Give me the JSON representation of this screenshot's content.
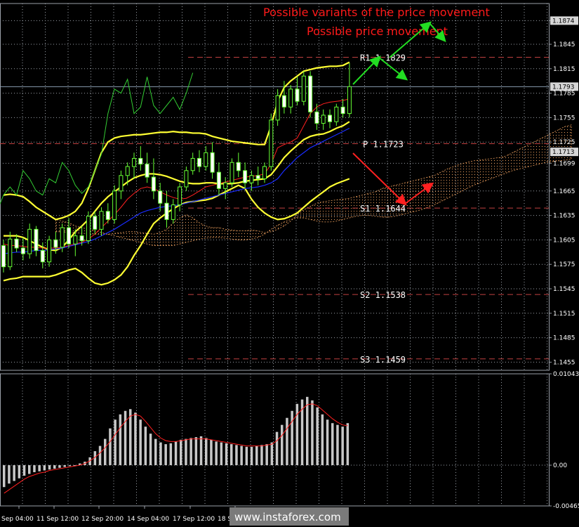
{
  "colors": {
    "background": "#000000",
    "grid": "#9aa0a8",
    "candle_up": "#66ff33",
    "candle_down": "#ffffff",
    "bollinger": "#ffff33",
    "kijun": "#ff2020",
    "tenkan": "#1a2cff",
    "chikou": "#33cc33",
    "cloud": "#f4a460",
    "histogram": "#c8c8c8",
    "signal": "#ff2020",
    "annotation_up": "#22dd22",
    "annotation_down": "#ff2020",
    "price_tag_bg": "#d6d6d6",
    "watermark_bg": "#7a7a7a"
  },
  "annotations": {
    "title1": "Possible variants of the price movement",
    "title2": "Possible price movement"
  },
  "watermark": "www.instaforex.com",
  "chart_data": [
    {
      "type": "candlestick",
      "panel": "price",
      "ylim": [
        1.1445,
        1.1895
      ],
      "y_ticks": [
        "1.1874",
        "1.1845",
        "1.1815",
        "1.1785",
        "1.1755",
        "1.1725",
        "1.1699",
        "1.1665",
        "1.1635",
        "1.1605",
        "1.1575",
        "1.1545",
        "1.1515",
        "1.1485",
        "1.1455"
      ],
      "x_labels": [
        "Sep 04:00",
        "11 Sep 12:00",
        "12 Sep 20:00",
        "14 Sep 04:00",
        "17 Sep 12:00",
        "18 Se"
      ],
      "price_tags": [
        {
          "value": 1.1874,
          "label": "1.1874"
        },
        {
          "value": 1.1793,
          "label": "1.1793"
        },
        {
          "value": 1.1713,
          "label": "1.1713"
        }
      ],
      "current_price": 1.1793,
      "levels": [
        {
          "name": "R1",
          "value": 1.1829,
          "label": "R1 1.1829"
        },
        {
          "name": "P",
          "value": 1.1723,
          "label": "P 1.1723"
        },
        {
          "name": "S1",
          "value": 1.1644,
          "label": "S1 1.1644"
        },
        {
          "name": "S2",
          "value": 1.1538,
          "label": "S2 1.1538"
        },
        {
          "name": "S3",
          "value": 1.1459,
          "label": "S3 1.1459"
        }
      ],
      "candles": [
        [
          1.1598,
          1.1605,
          1.1565,
          1.1572
        ],
        [
          1.1572,
          1.1615,
          1.1568,
          1.1606
        ],
        [
          1.1606,
          1.1612,
          1.159,
          1.1595
        ],
        [
          1.1595,
          1.1608,
          1.158,
          1.1588
        ],
        [
          1.1588,
          1.1625,
          1.1582,
          1.1618
        ],
        [
          1.1618,
          1.1622,
          1.1585,
          1.1592
        ],
        [
          1.1592,
          1.1602,
          1.157,
          1.1578
        ],
        [
          1.1578,
          1.161,
          1.1572,
          1.1605
        ],
        [
          1.1605,
          1.1615,
          1.1588,
          1.1596
        ],
        [
          1.1596,
          1.1625,
          1.159,
          1.162
        ],
        [
          1.162,
          1.1632,
          1.1595,
          1.16
        ],
        [
          1.16,
          1.1618,
          1.1585,
          1.161
        ],
        [
          1.161,
          1.1622,
          1.1598,
          1.1604
        ],
        [
          1.1604,
          1.164,
          1.16,
          1.1634
        ],
        [
          1.1634,
          1.164,
          1.1612,
          1.1618
        ],
        [
          1.1618,
          1.1645,
          1.161,
          1.164
        ],
        [
          1.164,
          1.165,
          1.1625,
          1.163
        ],
        [
          1.163,
          1.1672,
          1.1625,
          1.1665
        ],
        [
          1.1665,
          1.169,
          1.1655,
          1.1684
        ],
        [
          1.1684,
          1.17,
          1.1672,
          1.1695
        ],
        [
          1.1695,
          1.1712,
          1.168,
          1.1705
        ],
        [
          1.1705,
          1.172,
          1.169,
          1.1698
        ],
        [
          1.1698,
          1.1712,
          1.1675,
          1.1682
        ],
        [
          1.1682,
          1.1705,
          1.1655,
          1.1665
        ],
        [
          1.1665,
          1.1675,
          1.164,
          1.165
        ],
        [
          1.165,
          1.1665,
          1.162,
          1.163
        ],
        [
          1.163,
          1.1655,
          1.1625,
          1.1648
        ],
        [
          1.1648,
          1.1675,
          1.164,
          1.167
        ],
        [
          1.167,
          1.1695,
          1.1665,
          1.169
        ],
        [
          1.169,
          1.1712,
          1.1685,
          1.1705
        ],
        [
          1.1705,
          1.1715,
          1.1688,
          1.1695
        ],
        [
          1.1695,
          1.172,
          1.169,
          1.1712
        ],
        [
          1.1712,
          1.1725,
          1.168,
          1.1688
        ],
        [
          1.1688,
          1.17,
          1.166,
          1.1668
        ],
        [
          1.1668,
          1.1682,
          1.1655,
          1.1675
        ],
        [
          1.1675,
          1.1705,
          1.167,
          1.17
        ],
        [
          1.17,
          1.1712,
          1.1682,
          1.169
        ],
        [
          1.169,
          1.17,
          1.1668,
          1.1675
        ],
        [
          1.1675,
          1.169,
          1.1665,
          1.1684
        ],
        [
          1.1684,
          1.1695,
          1.1672,
          1.168
        ],
        [
          1.168,
          1.17,
          1.1675,
          1.1695
        ],
        [
          1.1695,
          1.176,
          1.169,
          1.1752
        ],
        [
          1.1752,
          1.179,
          1.1745,
          1.1782
        ],
        [
          1.1782,
          1.18,
          1.176,
          1.1768
        ],
        [
          1.1768,
          1.1795,
          1.176,
          1.179
        ],
        [
          1.179,
          1.1805,
          1.177,
          1.1775
        ],
        [
          1.1775,
          1.1812,
          1.177,
          1.1806
        ],
        [
          1.1806,
          1.1812,
          1.1755,
          1.1762
        ],
        [
          1.1762,
          1.1772,
          1.174,
          1.1748
        ],
        [
          1.1748,
          1.1765,
          1.174,
          1.1758
        ],
        [
          1.1758,
          1.1765,
          1.1742,
          1.175
        ],
        [
          1.175,
          1.1772,
          1.1745,
          1.1768
        ],
        [
          1.1768,
          1.1778,
          1.1755,
          1.176
        ],
        [
          1.176,
          1.1822,
          1.1755,
          1.1793
        ]
      ],
      "bollinger_upper": [
        1.166,
        1.1661,
        1.166,
        1.1658,
        1.1652,
        1.1645,
        1.164,
        1.1635,
        1.163,
        1.1632,
        1.1635,
        1.164,
        1.165,
        1.1668,
        1.169,
        1.1712,
        1.1725,
        1.173,
        1.1732,
        1.1733,
        1.1734,
        1.1734,
        1.1735,
        1.1736,
        1.1737,
        1.1737,
        1.1738,
        1.1737,
        1.1737,
        1.1736,
        1.1736,
        1.1735,
        1.1732,
        1.173,
        1.1728,
        1.1726,
        1.1725,
        1.1724,
        1.1723,
        1.1722,
        1.1722,
        1.1745,
        1.1775,
        1.1792,
        1.18,
        1.1806,
        1.1812,
        1.1814,
        1.1816,
        1.1817,
        1.1818,
        1.1818,
        1.1819,
        1.1823
      ],
      "bollinger_middle": [
        1.161,
        1.161,
        1.161,
        1.1608,
        1.1604,
        1.16,
        1.1596,
        1.1593,
        1.1592,
        1.1596,
        1.1605,
        1.1615,
        1.1622,
        1.163,
        1.164,
        1.165,
        1.1658,
        1.1664,
        1.167,
        1.1676,
        1.1681,
        1.1684,
        1.1686,
        1.1686,
        1.1685,
        1.1683,
        1.168,
        1.1677,
        1.1675,
        1.1674,
        1.1674,
        1.1675,
        1.1675,
        1.1674,
        1.1674,
        1.1674,
        1.1675,
        1.1677,
        1.1678,
        1.1679,
        1.168,
        1.1685,
        1.1695,
        1.1706,
        1.1714,
        1.1721,
        1.1728,
        1.1732,
        1.1734,
        1.1735,
        1.1738,
        1.1742,
        1.1745,
        1.175
      ],
      "bollinger_lower": [
        1.1555,
        1.1557,
        1.1558,
        1.156,
        1.156,
        1.156,
        1.156,
        1.156,
        1.1562,
        1.1565,
        1.1568,
        1.157,
        1.1565,
        1.1558,
        1.1552,
        1.155,
        1.1552,
        1.1556,
        1.1562,
        1.1572,
        1.1586,
        1.1598,
        1.1612,
        1.1625,
        1.1632,
        1.1638,
        1.1643,
        1.1648,
        1.1651,
        1.1652,
        1.1653,
        1.1654,
        1.1656,
        1.166,
        1.1664,
        1.1668,
        1.1672,
        1.1668,
        1.1655,
        1.1645,
        1.1638,
        1.1633,
        1.163,
        1.1631,
        1.1634,
        1.1638,
        1.1645,
        1.1652,
        1.1658,
        1.1664,
        1.167,
        1.1674,
        1.1677,
        1.168
      ],
      "kijun_sen": [
        1.16,
        1.1598,
        1.1598,
        1.1597,
        1.1596,
        1.1596,
        1.1595,
        1.1595,
        1.1595,
        1.1596,
        1.1598,
        1.16,
        1.1602,
        1.1606,
        1.1612,
        1.162,
        1.1628,
        1.1636,
        1.1645,
        1.1655,
        1.1662,
        1.1668,
        1.167,
        1.1668,
        1.1664,
        1.166,
        1.1657,
        1.1655,
        1.1656,
        1.166,
        1.1665,
        1.167,
        1.1672,
        1.1674,
        1.1676,
        1.1678,
        1.168,
        1.1682,
        1.1683,
        1.1684,
        1.1686,
        1.1698,
        1.1718,
        1.1722,
        1.1725,
        1.173,
        1.1745,
        1.176,
        1.1768,
        1.1772,
        1.1774,
        1.1775,
        1.1776,
        1.1778
      ],
      "tenkan_sen": [
        1.1588,
        1.1589,
        1.159,
        1.159,
        1.1591,
        1.1592,
        1.1592,
        1.1593,
        1.1594,
        1.1595,
        1.1597,
        1.1599,
        1.1601,
        1.1603,
        1.1606,
        1.161,
        1.1614,
        1.1618,
        1.1623,
        1.1628,
        1.1633,
        1.1638,
        1.1641,
        1.1643,
        1.1645,
        1.1646,
        1.1647,
        1.1648,
        1.165,
        1.1652,
        1.1654,
        1.1656,
        1.1658,
        1.166,
        1.1662,
        1.1664,
        1.1666,
        1.1668,
        1.1669,
        1.167,
        1.1672,
        1.1675,
        1.168,
        1.169,
        1.1698,
        1.1706,
        1.1712,
        1.1718,
        1.1722,
        1.1726,
        1.173,
        1.1734,
        1.1738,
        1.1742
      ],
      "chikou_span": [
        1.163,
        1.164,
        1.166,
        1.167,
        1.166,
        1.169,
        1.168,
        1.1665,
        1.166,
        1.168,
        1.1675,
        1.17,
        1.169,
        1.1672,
        1.1662,
        1.167,
        1.169,
        1.171,
        1.176,
        1.179,
        1.1785,
        1.1802,
        1.176,
        1.1768,
        1.1805,
        1.177,
        1.176,
        1.177,
        1.178,
        1.1765,
        1.1785,
        1.181
      ],
      "cloud_top": [
        1.1615,
        1.1615,
        1.1614,
        1.1614,
        1.1613,
        1.1613,
        1.1612,
        1.1612,
        1.1612,
        1.1613,
        1.1614,
        1.1615,
        1.1615,
        1.1614,
        1.1613,
        1.1612,
        1.1614,
        1.1618,
        1.1626,
        1.1632,
        1.1636,
        1.1632,
        1.1626,
        1.1622,
        1.162,
        1.162,
        1.1618,
        1.1617,
        1.1616,
        1.1616,
        1.1617,
        1.1616,
        1.1614,
        1.1615,
        1.1618,
        1.1622,
        1.1628,
        1.1636,
        1.1642,
        1.1646,
        1.165,
        1.1652,
        1.1653,
        1.1654,
        1.1655,
        1.1656,
        1.1658,
        1.166,
        1.1662,
        1.1664,
        1.1668,
        1.167,
        1.1672,
        1.1674,
        1.1676,
        1.1678,
        1.168,
        1.1682,
        1.1684,
        1.1688,
        1.1692,
        1.1695,
        1.1698,
        1.17,
        1.1702,
        1.1703,
        1.1704,
        1.1705,
        1.1706,
        1.1708,
        1.1712,
        1.1716,
        1.172,
        1.1724,
        1.1728,
        1.1732,
        1.1736,
        1.174,
        1.1744,
        1.1746
      ],
      "cloud_bottom": [
        1.163,
        1.1628,
        1.1626,
        1.1622,
        1.162,
        1.1618,
        1.1616,
        1.1614,
        1.1612,
        1.161,
        1.1608,
        1.1606,
        1.1604,
        1.1602,
        1.16,
        1.1598,
        1.1598,
        1.1598,
        1.1598,
        1.16,
        1.1602,
        1.1604,
        1.1606,
        1.1607,
        1.1608,
        1.1608,
        1.1607,
        1.1606,
        1.1605,
        1.1605,
        1.1606,
        1.1608,
        1.1612,
        1.1618,
        1.1623,
        1.1627,
        1.163,
        1.1632,
        1.1632,
        1.163,
        1.1628,
        1.1627,
        1.1627,
        1.1628,
        1.163,
        1.1632,
        1.1634,
        1.1635,
        1.1635,
        1.1634,
        1.1633,
        1.1633,
        1.1634,
        1.1636,
        1.1638,
        1.164,
        1.1642,
        1.1645,
        1.1648,
        1.1652,
        1.1656,
        1.166,
        1.1664,
        1.1668,
        1.1672,
        1.1675,
        1.1678,
        1.1681,
        1.1684,
        1.1687,
        1.169,
        1.1692,
        1.1694,
        1.1696,
        1.1698,
        1.17,
        1.1701,
        1.1702,
        1.1703,
        1.1704
      ],
      "cloud_start_index": 8
    },
    {
      "type": "bar",
      "panel": "oscillator",
      "ylim": [
        -0.00465,
        0.01043
      ],
      "y_ticks": [
        "0.01043",
        "0.00",
        "-0.00465"
      ],
      "histogram": [
        -0.0025,
        -0.0021,
        -0.0018,
        -0.0015,
        -0.0012,
        -0.001,
        -0.0008,
        -0.0007,
        -0.0006,
        -0.0005,
        -0.0004,
        -0.0003,
        -0.0002,
        -0.0001,
        0.0,
        0.0002,
        0.0004,
        0.0009,
        0.0016,
        0.0022,
        0.003,
        0.0042,
        0.0052,
        0.0058,
        0.0062,
        0.0064,
        0.006,
        0.0052,
        0.0044,
        0.0036,
        0.003,
        0.0026,
        0.0024,
        0.0025,
        0.0027,
        0.0029,
        0.003,
        0.0031,
        0.0032,
        0.0033,
        0.0031,
        0.0029,
        0.0027,
        0.0026,
        0.0025,
        0.0024,
        0.0023,
        0.0022,
        0.0021,
        0.0021,
        0.0022,
        0.0023,
        0.0024,
        0.0026,
        0.0038,
        0.0046,
        0.0054,
        0.0062,
        0.007,
        0.0075,
        0.0078,
        0.0074,
        0.0066,
        0.0058,
        0.0052,
        0.0048,
        0.0046,
        0.0044,
        0.0048
      ],
      "signal": [
        -0.0032,
        -0.0028,
        -0.0024,
        -0.002,
        -0.0016,
        -0.0013,
        -0.0011,
        -0.0009,
        -0.0008,
        -0.0006,
        -0.0005,
        -0.0004,
        -0.0003,
        -0.0002,
        -0.0001,
        0.0,
        0.0002,
        0.0005,
        0.0009,
        0.0014,
        0.002,
        0.0027,
        0.0035,
        0.0043,
        0.005,
        0.0056,
        0.0058,
        0.0056,
        0.005,
        0.0043,
        0.0036,
        0.0031,
        0.0028,
        0.0027,
        0.0027,
        0.0028,
        0.0029,
        0.003,
        0.003,
        0.003,
        0.003,
        0.0029,
        0.0028,
        0.0027,
        0.0026,
        0.0025,
        0.0024,
        0.0023,
        0.0022,
        0.0022,
        0.0022,
        0.0022,
        0.0023,
        0.0024,
        0.0028,
        0.0034,
        0.0042,
        0.005,
        0.0058,
        0.0064,
        0.0069,
        0.007,
        0.0068,
        0.0063,
        0.0058,
        0.0053,
        0.0049,
        0.0046,
        0.0045
      ]
    }
  ]
}
